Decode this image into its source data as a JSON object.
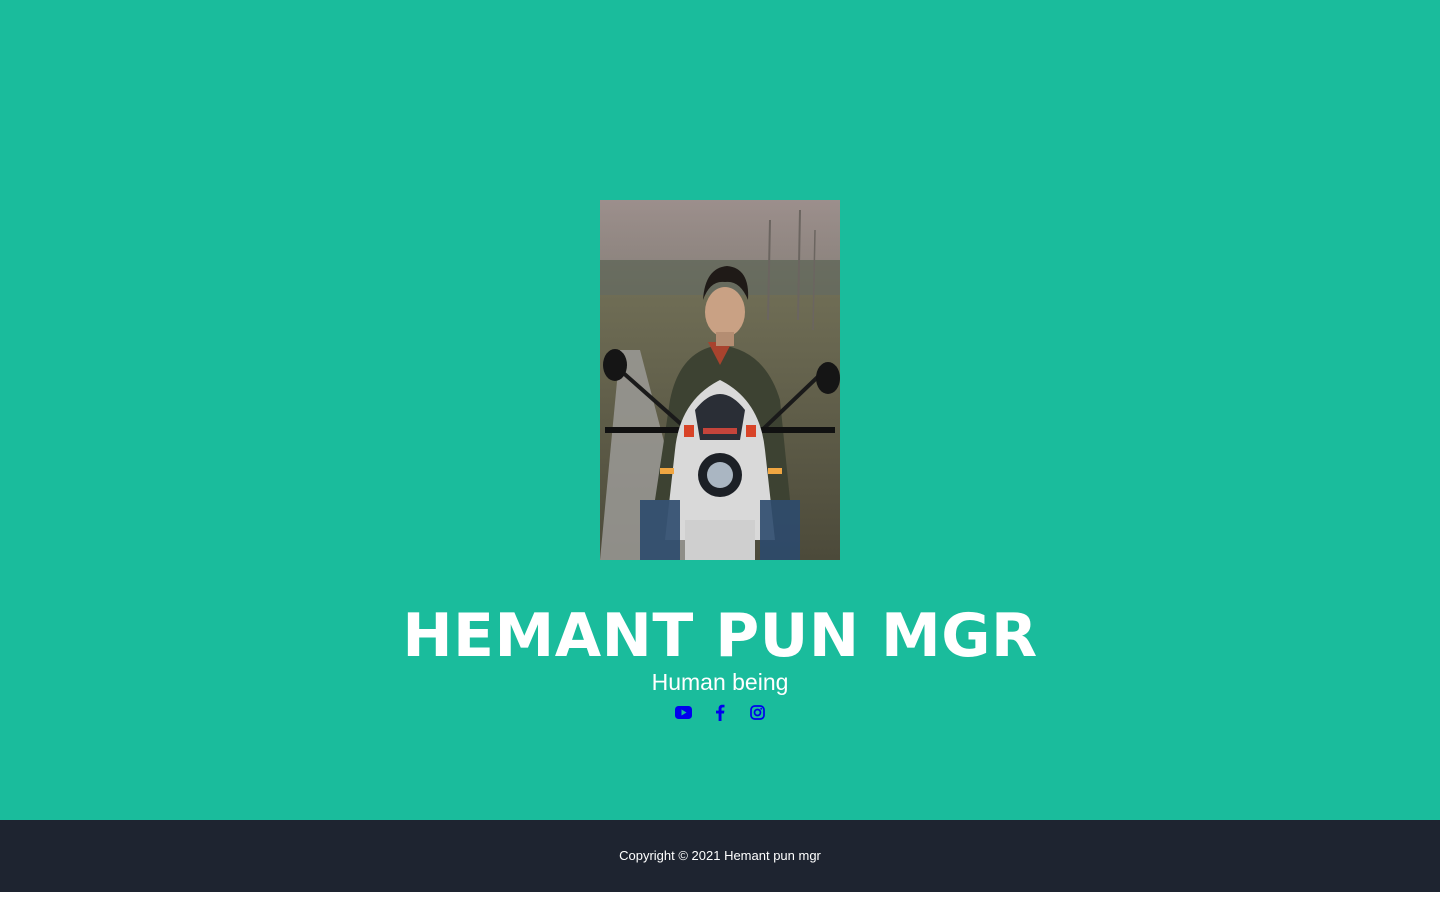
{
  "profile": {
    "name": "HEMANT PUN MGR",
    "tagline": "Human being",
    "photo_alt": "Profile photo"
  },
  "colors": {
    "masthead_bg": "#1abc9c",
    "footer_bg": "#1e2430",
    "icon_color": "#0000ee",
    "text": "#ffffff"
  },
  "socials": [
    {
      "icon": "youtube-icon"
    },
    {
      "icon": "facebook-icon"
    },
    {
      "icon": "instagram-icon"
    }
  ],
  "footer": {
    "copyright": "Copyright © 2021 Hemant pun mgr"
  }
}
